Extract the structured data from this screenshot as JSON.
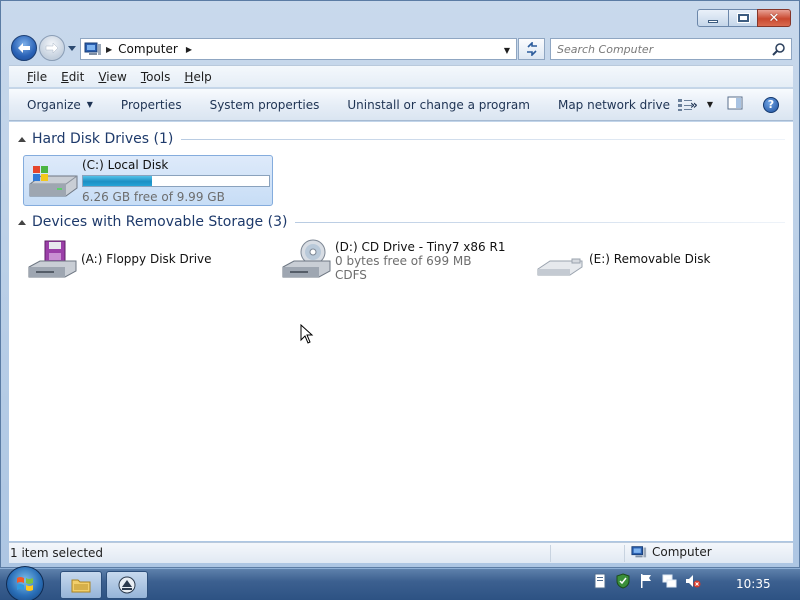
{
  "address": {
    "location": "Computer"
  },
  "search": {
    "placeholder": "Search Computer"
  },
  "menu": [
    "File",
    "Edit",
    "View",
    "Tools",
    "Help"
  ],
  "toolbar": {
    "organize": "Organize",
    "properties": "Properties",
    "system_properties": "System properties",
    "uninstall": "Uninstall or change a program",
    "map_drive": "Map network drive",
    "more": "»"
  },
  "groups": [
    {
      "title": "Hard Disk Drives (1)"
    },
    {
      "title": "Devices with Removable Storage (3)"
    }
  ],
  "drives": [
    {
      "name": "(C:) Local Disk",
      "free_text": "6.26 GB free of 9.99 GB",
      "used_fraction": 0.373,
      "selected": true
    },
    {
      "name": "(A:) Floppy Disk Drive"
    },
    {
      "name": "(D:) CD Drive - Tiny7 x86 R1",
      "free_text": "0 bytes free of 699 MB",
      "filesystem": "CDFS"
    },
    {
      "name": "(E:) Removable Disk"
    }
  ],
  "status": {
    "selection": "1 item selected",
    "location": "Computer"
  },
  "taskbar": {
    "clock": "10:35"
  },
  "colors": {
    "accent": "#1c8fc4",
    "group_title": "#1e3a6b",
    "close_button": "#c9482f"
  },
  "icons": [
    "back-arrow-icon",
    "forward-arrow-icon",
    "computer-icon",
    "refresh-icon",
    "search-icon",
    "view-options-icon",
    "preview-pane-icon",
    "help-icon",
    "hard-drive-icon",
    "floppy-drive-icon",
    "cd-drive-icon",
    "removable-disk-icon",
    "windows-logo-icon",
    "explorer-folder-icon",
    "media-icon",
    "action-center-icon",
    "network-icon",
    "volume-muted-icon"
  ]
}
